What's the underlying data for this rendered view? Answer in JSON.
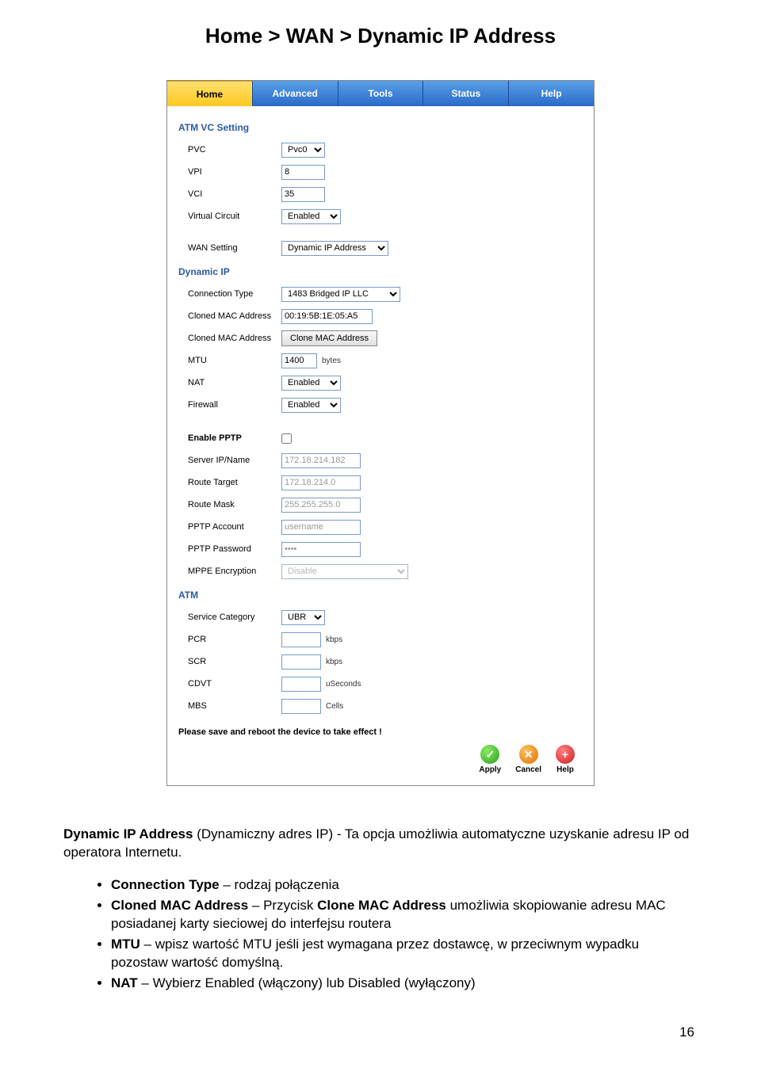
{
  "page_title": "Home > WAN > Dynamic IP Address",
  "tabs": [
    "Home",
    "Advanced",
    "Tools",
    "Status",
    "Help"
  ],
  "active_tab": 0,
  "sections": {
    "atm_vc": {
      "header": "ATM VC Setting",
      "pvc_label": "PVC",
      "pvc_value": "Pvc0",
      "vpi_label": "VPI",
      "vpi_value": "8",
      "vci_label": "VCI",
      "vci_value": "35",
      "vc_label": "Virtual Circuit",
      "vc_value": "Enabled",
      "wan_label": "WAN Setting",
      "wan_value": "Dynamic IP Address"
    },
    "dynamic_ip": {
      "header": "Dynamic IP",
      "conn_type_label": "Connection Type",
      "conn_type_value": "1483 Bridged IP LLC",
      "cloned_mac1_label": "Cloned MAC Address",
      "cloned_mac1_value": "00:19:5B:1E:05:A5",
      "cloned_mac2_label": "Cloned MAC Address",
      "cloned_mac2_btn": "Clone MAC Address",
      "mtu_label": "MTU",
      "mtu_value": "1400",
      "mtu_unit": "bytes",
      "nat_label": "NAT",
      "nat_value": "Enabled",
      "firewall_label": "Firewall",
      "firewall_value": "Enabled"
    },
    "pptp": {
      "enable_label": "Enable PPTP",
      "server_label": "Server IP/Name",
      "server_value": "172.18.214.182",
      "route_target_label": "Route Target",
      "route_target_value": "172.18.214.0",
      "route_mask_label": "Route Mask",
      "route_mask_value": "255.255.255.0",
      "account_label": "PPTP Account",
      "account_value": "username",
      "password_label": "PPTP Password",
      "password_value": "••••",
      "mppe_label": "MPPE Encryption",
      "mppe_value": "Disable"
    },
    "atm": {
      "header": "ATM",
      "service_cat_label": "Service Category",
      "service_cat_value": "UBR",
      "pcr_label": "PCR",
      "pcr_unit": "kbps",
      "scr_label": "SCR",
      "scr_unit": "kbps",
      "cdvt_label": "CDVT",
      "cdvt_unit": "uSeconds",
      "mbs_label": "MBS",
      "mbs_unit": "Cells"
    }
  },
  "save_note": "Please save and reboot the device to take effect !",
  "actions": {
    "apply": "Apply",
    "cancel": "Cancel",
    "help": "Help"
  },
  "description": {
    "intro_bold": "Dynamic IP Address",
    "intro_rest": " (Dynamiczny adres IP) - Ta opcja umożliwia automatyczne uzyskanie adresu IP od operatora Internetu.",
    "bullets": [
      {
        "b": "Connection Type",
        "t": " – rodzaj połączenia"
      },
      {
        "b": "Cloned MAC Address",
        "t": " – Przycisk ",
        "b2": "Clone MAC Address",
        "t2": " umożliwia skopiowanie adresu MAC posiadanej karty sieciowej do interfejsu routera"
      },
      {
        "b": "MTU",
        "t": " – wpisz wartość MTU jeśli jest wymagana przez dostawcę, w przeciwnym wypadku pozostaw wartość domyślną."
      },
      {
        "b": "NAT",
        "t": " – Wybierz Enabled (włączony) lub Disabled (wyłączony)"
      }
    ]
  },
  "page_number": "16"
}
